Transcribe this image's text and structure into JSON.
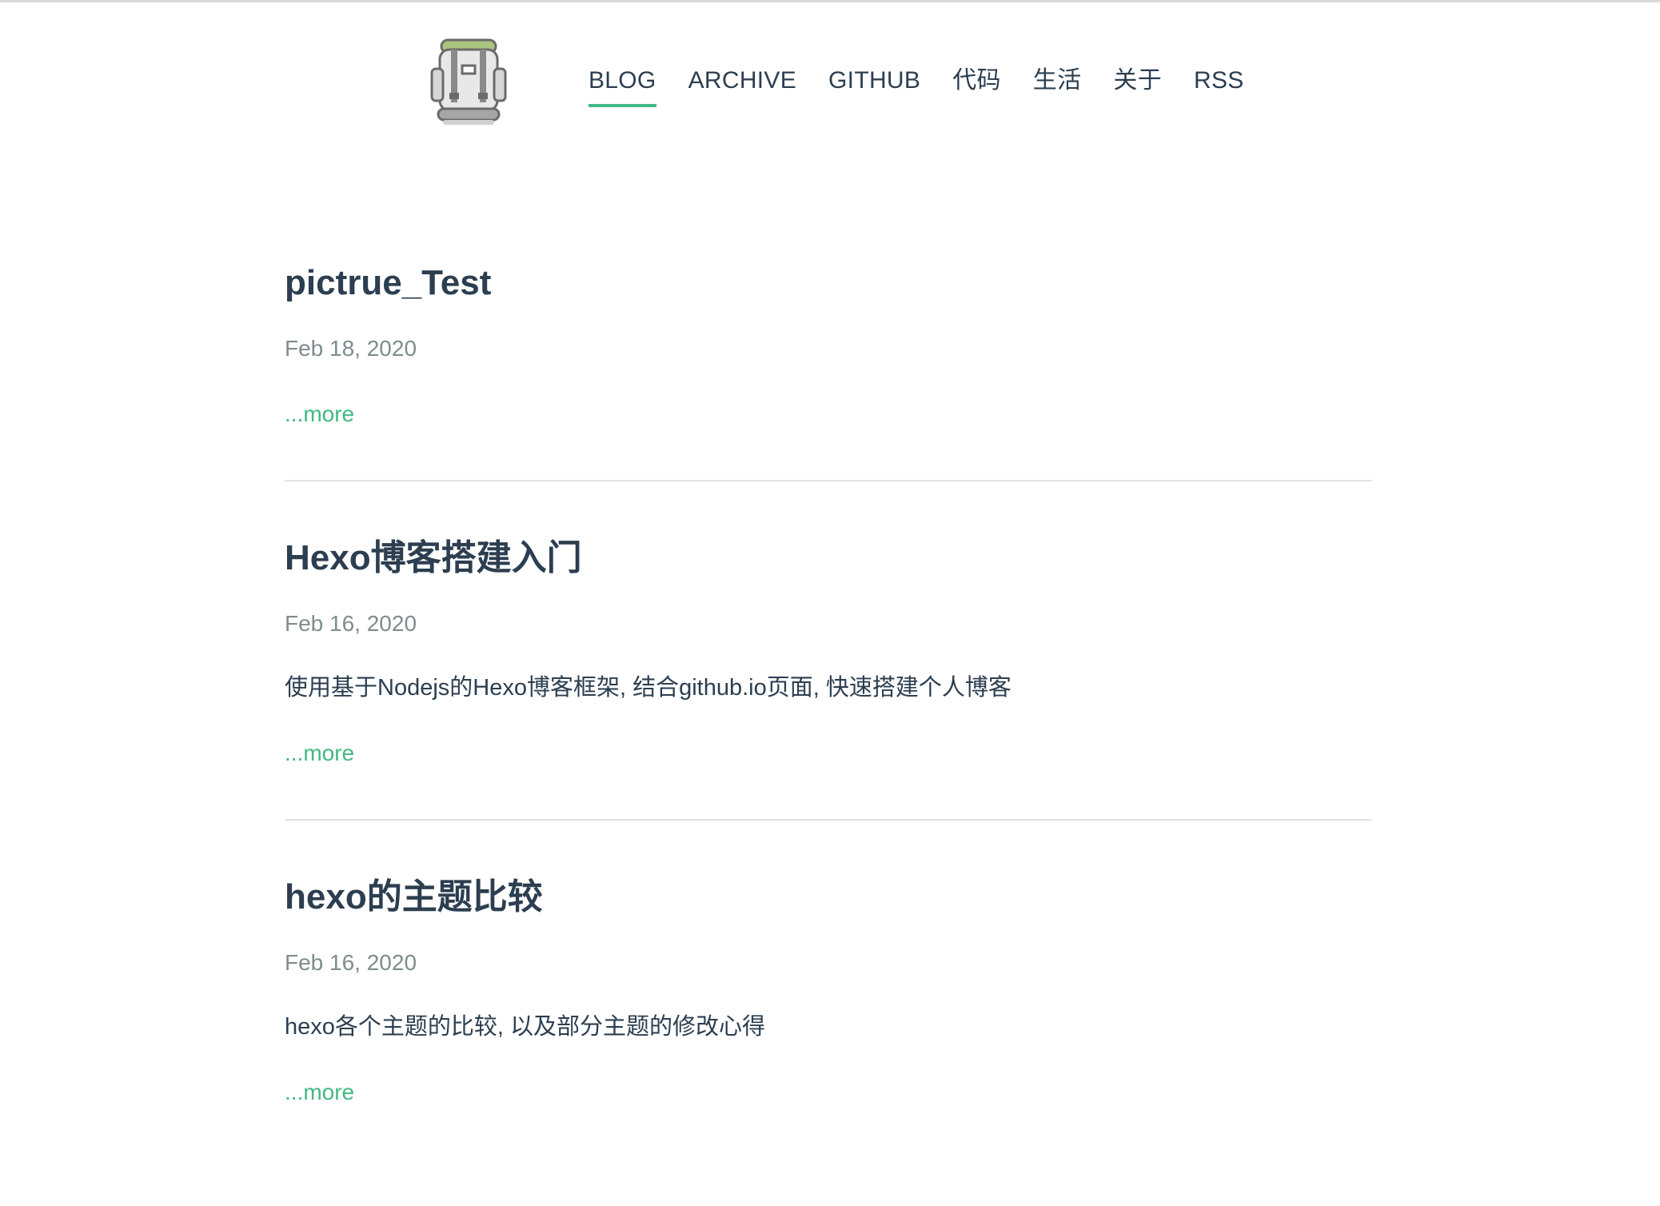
{
  "colors": {
    "accent": "#42b983",
    "text": "#2c3e50",
    "muted": "#7f8c8d",
    "divider": "#e3e3e3"
  },
  "logo": {
    "icon": "backpack-icon"
  },
  "nav": {
    "items": [
      {
        "label": "BLOG",
        "active": true
      },
      {
        "label": "ARCHIVE",
        "active": false
      },
      {
        "label": "GITHUB",
        "active": false
      },
      {
        "label": "代码",
        "active": false
      },
      {
        "label": "生活",
        "active": false
      },
      {
        "label": "关于",
        "active": false
      },
      {
        "label": "RSS",
        "active": false
      }
    ]
  },
  "posts": [
    {
      "title": "pictrue_Test",
      "date": "Feb 18, 2020",
      "description": "",
      "more": "...more"
    },
    {
      "title": "Hexo博客搭建入门",
      "date": "Feb 16, 2020",
      "description": "使用基于Nodejs的Hexo博客框架, 结合github.io页面, 快速搭建个人博客",
      "more": "...more"
    },
    {
      "title": "hexo的主题比较",
      "date": "Feb 16, 2020",
      "description": "hexo各个主题的比较, 以及部分主题的修改心得",
      "more": "...more"
    }
  ]
}
